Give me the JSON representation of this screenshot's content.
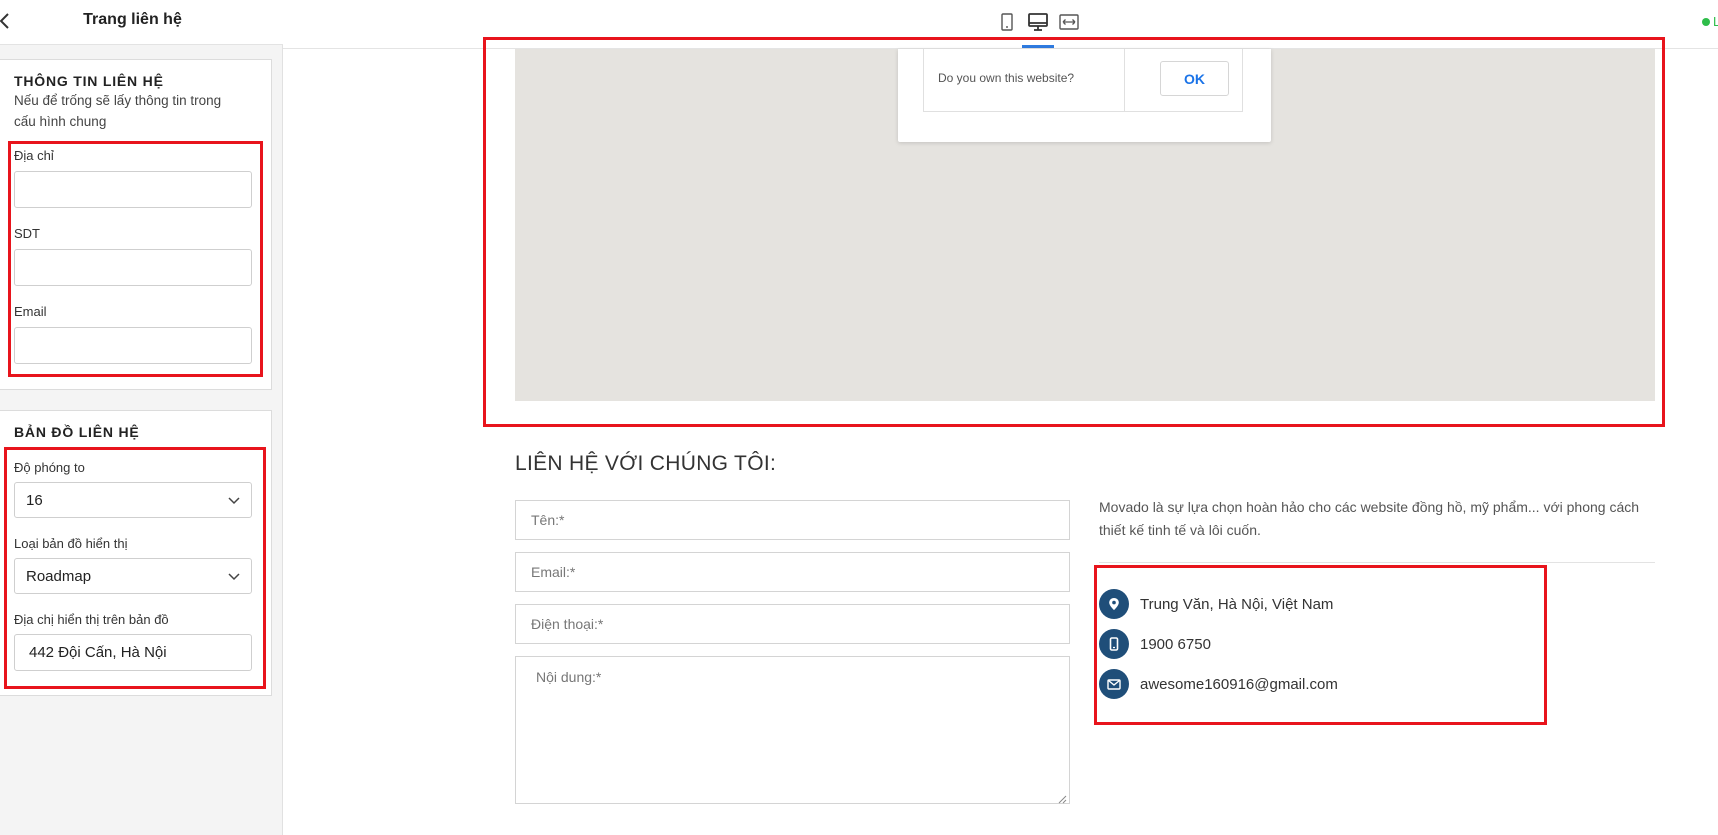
{
  "sidebar": {
    "title": "Trang liên hệ",
    "contact_info": {
      "title": "THÔNG TIN LIÊN HỆ",
      "note": "Nếu để trống sẽ lấy thông tin trong cấu hình chung",
      "address_label": "Địa chỉ",
      "address_value": "",
      "phone_label": "SDT",
      "phone_value": "",
      "email_label": "Email",
      "email_value": ""
    },
    "map_section": {
      "title": "BẢN ĐỒ LIÊN HỆ",
      "zoom_label": "Độ phóng to",
      "zoom_value": "16",
      "type_label": "Loại bản đồ hiển thị",
      "type_value": "Roadmap",
      "address_label": "Địa chị hiển thị trên bản đồ",
      "address_value": "442 Đội Cấn, Hà Nội"
    }
  },
  "topbar": {
    "devices": [
      "mobile-icon",
      "desktop-icon",
      "fullwidth-icon"
    ],
    "active_device": "desktop",
    "status_text": "L",
    "accent_color": "#2f7be0",
    "status_color": "#2ebd4a"
  },
  "preview": {
    "map_dialog": {
      "question": "Do you own this website?",
      "ok_label": "OK"
    },
    "heading": "LIÊN HỆ VỚI CHÚNG TÔI:",
    "form": {
      "name_placeholder": "Tên:*",
      "email_placeholder": "Email:*",
      "phone_placeholder": "Điện thoại:*",
      "message_placeholder": "Nội dung:*"
    },
    "description": "Movado là sự lựa chọn hoàn hảo cho các website đồng hồ, mỹ phẩm... với phong cách thiết kế tinh tế và lôi cuốn.",
    "contact": {
      "address": "Trung Văn, Hà Nội, Việt Nam",
      "phone": "1900 6750",
      "email": "awesome160916@gmail.com",
      "icon_color": "#1f4e79"
    },
    "highlight_color": "#e8141c"
  }
}
